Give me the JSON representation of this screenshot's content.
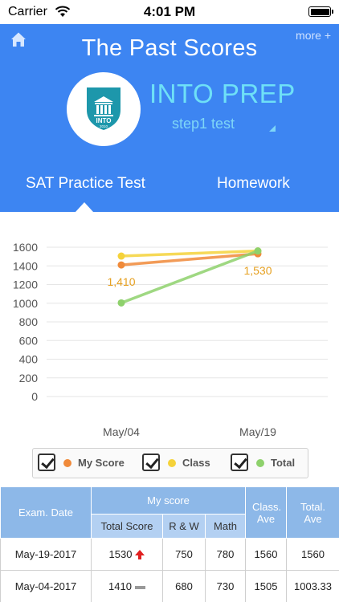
{
  "status_bar": {
    "carrier": "Carrier",
    "time": "4:01 PM"
  },
  "header": {
    "title": "The Past Scores",
    "more_label": "more +",
    "brand_name": "INTO PREP",
    "brand_sub": "step1 test",
    "logo_text": "INTO",
    "logo_year": "2010"
  },
  "tabs": [
    {
      "label": "SAT Practice Test",
      "active": true
    },
    {
      "label": "Homework",
      "active": false
    }
  ],
  "chart_data": {
    "type": "line",
    "categories": [
      "May/04",
      "May/19"
    ],
    "ylim": [
      0,
      1600
    ],
    "yticks": [
      0,
      200,
      400,
      600,
      800,
      1000,
      1200,
      1400,
      1600
    ],
    "grid": true,
    "series": [
      {
        "name": "My Score",
        "color": "#f08a3a",
        "values": [
          1410,
          1530
        ]
      },
      {
        "name": "Class",
        "color": "#f5d23a",
        "values": [
          1505,
          1560
        ]
      },
      {
        "name": "Total",
        "color": "#8ed16c",
        "values": [
          1003.33,
          1560
        ]
      }
    ],
    "data_labels": [
      {
        "series": "My Score",
        "index": 0,
        "text": "1,410"
      },
      {
        "series": "My Score",
        "index": 1,
        "text": "1,530"
      }
    ]
  },
  "legend": [
    {
      "label": "My Score",
      "color": "#f08a3a",
      "checked": true
    },
    {
      "label": "Class",
      "color": "#f5d23a",
      "checked": true
    },
    {
      "label": "Total",
      "color": "#8ed16c",
      "checked": true
    }
  ],
  "table": {
    "headers": {
      "exam_date": "Exam. Date",
      "my_score": "My score",
      "total_score": "Total Score",
      "rw": "R & W",
      "math": "Math",
      "class_ave": "Class. Ave",
      "total_ave": "Total. Ave"
    },
    "rows": [
      {
        "date": "May-19-2017",
        "total": "1530",
        "trend": "up",
        "rw": "750",
        "math": "780",
        "class_ave": "1560",
        "total_ave": "1560"
      },
      {
        "date": "May-04-2017",
        "total": "1410",
        "trend": "flat",
        "rw": "680",
        "math": "730",
        "class_ave": "1505",
        "total_ave": "1003.33"
      }
    ]
  },
  "colors": {
    "header_bg": "#3d85f2",
    "brand_accent": "#6ee0f7",
    "table_header": "#8db8e8"
  }
}
